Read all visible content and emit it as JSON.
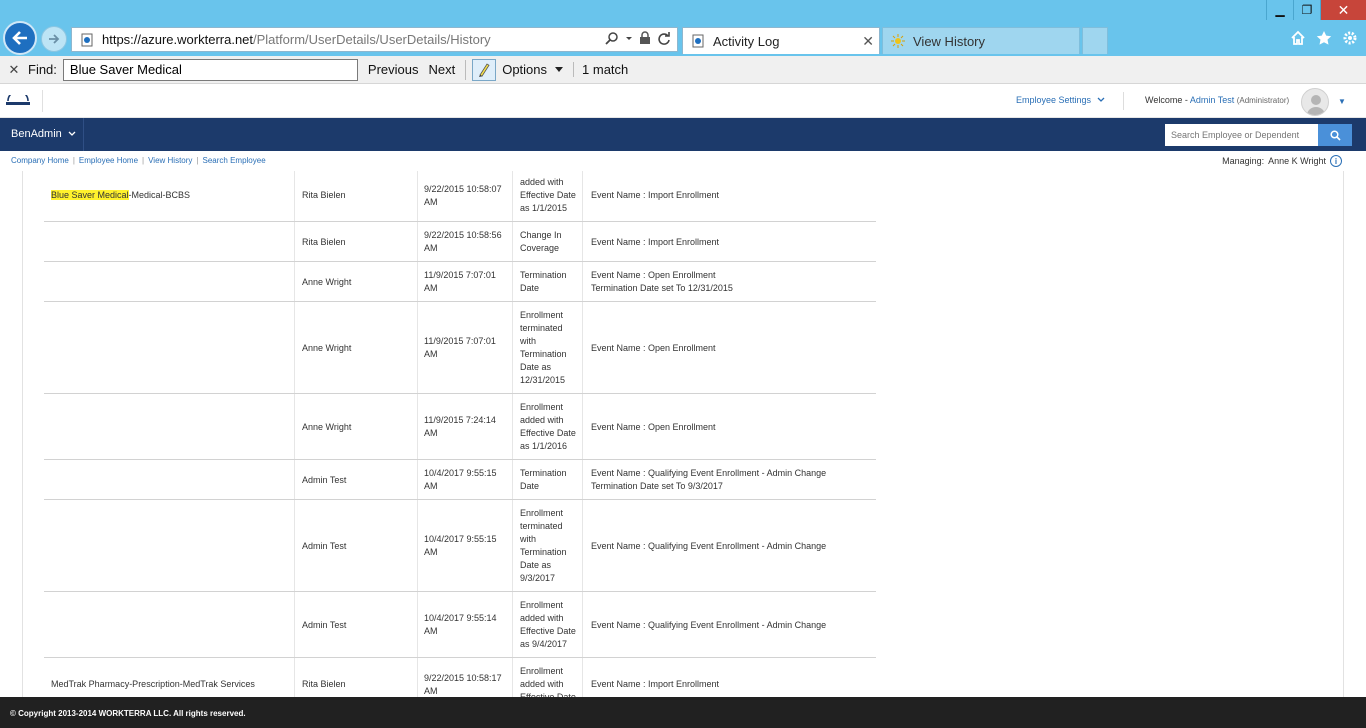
{
  "browser": {
    "url_host": "https://azure.workterra.net",
    "url_path": "/Platform/UserDetails/UserDetails/History",
    "tabs": [
      {
        "label": "Activity Log",
        "active": true
      },
      {
        "label": "View History",
        "active": false
      }
    ],
    "window_buttons": {
      "minimize": "▁",
      "restore": "❐",
      "close": "✕"
    }
  },
  "findbar": {
    "close": "✕",
    "label": "Find:",
    "query": "Blue Saver Medical",
    "previous": "Previous",
    "next": "Next",
    "options": "Options",
    "match_count": "1 match"
  },
  "header": {
    "employee_settings": "Employee Settings",
    "welcome_prefix": "Welcome -",
    "user_name": "Admin Test",
    "user_role": "(Administrator)"
  },
  "nav": {
    "brand": "BenAdmin",
    "search_placeholder": "Search Employee or Dependent"
  },
  "breadcrumbs": [
    "Company Home",
    "Employee Home",
    "View History",
    "Search Employee"
  ],
  "managing": {
    "label": "Managing:",
    "name": "Anne K Wright"
  },
  "history_rows": [
    {
      "plan_highlight": "Blue Saver Medical",
      "plan_rest": "-Medical-BCBS",
      "changed_by": "Rita Bielen",
      "date": [
        "9/22/2015 10:58:07",
        "AM"
      ],
      "description": [
        "added with",
        "Effective Date",
        "as 1/1/2015"
      ],
      "notes": [
        "Event Name : Import Enrollment"
      ]
    },
    {
      "plan_highlight": "",
      "plan_rest": "",
      "changed_by": "Rita Bielen",
      "date": [
        "9/22/2015 10:58:56",
        "AM"
      ],
      "description": [
        "Change In",
        "Coverage"
      ],
      "notes": [
        "Event Name : Import Enrollment"
      ]
    },
    {
      "plan_highlight": "",
      "plan_rest": "",
      "changed_by": "Anne Wright",
      "date": [
        "11/9/2015 7:07:01",
        "AM"
      ],
      "description": [
        "Termination",
        "Date"
      ],
      "notes": [
        "Event Name : Open Enrollment",
        "Termination Date set To 12/31/2015"
      ]
    },
    {
      "plan_highlight": "",
      "plan_rest": "",
      "changed_by": "Anne Wright",
      "date": [
        "11/9/2015 7:07:01",
        "AM"
      ],
      "description": [
        "Enrollment",
        "terminated",
        "with",
        "Termination",
        "Date as",
        "12/31/2015"
      ],
      "notes": [
        "Event Name : Open Enrollment"
      ]
    },
    {
      "plan_highlight": "",
      "plan_rest": "",
      "changed_by": "Anne Wright",
      "date": [
        "11/9/2015 7:24:14",
        "AM"
      ],
      "description": [
        "Enrollment",
        "added with",
        "Effective Date",
        "as 1/1/2016"
      ],
      "notes": [
        "Event Name : Open Enrollment"
      ]
    },
    {
      "plan_highlight": "",
      "plan_rest": "",
      "changed_by": "Admin Test",
      "date": [
        "10/4/2017 9:55:15",
        "AM"
      ],
      "description": [
        "Termination",
        "Date"
      ],
      "notes": [
        "Event Name : Qualifying Event Enrollment - Admin Change",
        "Termination Date set To 9/3/2017"
      ]
    },
    {
      "plan_highlight": "",
      "plan_rest": "",
      "changed_by": "Admin Test",
      "date": [
        "10/4/2017 9:55:15",
        "AM"
      ],
      "description": [
        "Enrollment",
        "terminated",
        "with",
        "Termination",
        "Date as",
        "9/3/2017"
      ],
      "notes": [
        "Event Name : Qualifying Event Enrollment - Admin Change"
      ]
    },
    {
      "plan_highlight": "",
      "plan_rest": "",
      "changed_by": "Admin Test",
      "date": [
        "10/4/2017 9:55:14",
        "AM"
      ],
      "description": [
        "Enrollment",
        "added with",
        "Effective Date",
        "as 9/4/2017"
      ],
      "notes": [
        "Event Name : Qualifying Event Enrollment - Admin Change"
      ]
    },
    {
      "plan_highlight": "",
      "plan_rest": "MedTrak Pharmacy-Prescription-MedTrak Services",
      "changed_by": "Rita Bielen",
      "date": [
        "9/22/2015 10:58:17",
        "AM"
      ],
      "description": [
        "Enrollment",
        "added with",
        "Effective Date"
      ],
      "notes": [
        "Event Name : Import Enrollment"
      ]
    }
  ],
  "footer": {
    "copyright": "© Copyright 2013-2014 WORKTERRA LLC. All rights reserved."
  },
  "colors": {
    "chrome": "#69c4ec",
    "nav": "#1c3a6b",
    "link": "#2a6fb6",
    "highlight": "#fff12c",
    "footer": "#212121"
  }
}
